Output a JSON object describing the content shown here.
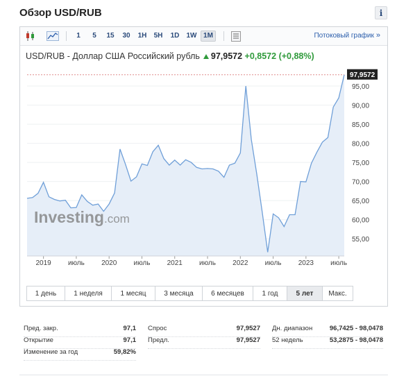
{
  "page": {
    "title": "Обзор USD/RUB",
    "info_icon": "info-icon",
    "info_glyph": "i"
  },
  "toolbar": {
    "icons": [
      "candlestick-icon",
      "area-chart-icon",
      "indicators-icon"
    ],
    "timeframes": [
      "1",
      "5",
      "15",
      "30",
      "1H",
      "5H",
      "1D",
      "1W",
      "1M"
    ],
    "active_timeframe": "1M",
    "stream_link": "Потоковый график",
    "stream_chevron": "»"
  },
  "chart_header": {
    "symbol": "USD/RUB - Доллар США Российский рубль",
    "price": "97,9572",
    "change": "+0,8572",
    "change_pct": "(+0,88%)"
  },
  "chart_data": {
    "type": "area",
    "title": "",
    "x_labels": [
      "2019",
      "июль",
      "2020",
      "июль",
      "2021",
      "июль",
      "2022",
      "июль",
      "2023",
      "июль"
    ],
    "y_ticks": [
      55.0,
      60.0,
      65.0,
      70.0,
      75.0,
      80.0,
      85.0,
      90.0,
      95.0
    ],
    "y_tick_labels": [
      "55,00",
      "60,00",
      "65,00",
      "70,00",
      "75,00",
      "80,00",
      "85,00",
      "90,00",
      "95,00"
    ],
    "ylim": [
      50.5,
      99
    ],
    "last_price": 97.9572,
    "last_price_label": "97,9572",
    "watermark": "Investing.com",
    "series": [
      {
        "x": [
          "2018-10",
          "2018-11",
          "2018-12",
          "2019-01",
          "2019-02",
          "2019-03",
          "2019-04",
          "2019-05",
          "2019-06",
          "2019-07",
          "2019-08",
          "2019-09",
          "2019-10",
          "2019-11",
          "2019-12",
          "2020-01",
          "2020-02",
          "2020-03",
          "2020-04",
          "2020-05",
          "2020-06",
          "2020-07",
          "2020-08",
          "2020-09",
          "2020-10",
          "2020-11",
          "2020-12",
          "2021-01",
          "2021-02",
          "2021-03",
          "2021-04",
          "2021-05",
          "2021-06",
          "2021-07",
          "2021-08",
          "2021-09",
          "2021-10",
          "2021-11",
          "2021-12",
          "2022-01",
          "2022-02",
          "2022-03",
          "2022-04",
          "2022-05",
          "2022-06",
          "2022-07",
          "2022-08",
          "2022-09",
          "2022-10",
          "2022-11",
          "2022-12",
          "2023-01",
          "2023-02",
          "2023-03",
          "2023-04",
          "2023-05",
          "2023-06",
          "2023-07",
          "2023-08"
        ],
        "y": [
          65.6,
          65.8,
          66.9,
          69.8,
          66.0,
          65.3,
          64.9,
          65.1,
          63.1,
          63.2,
          66.5,
          64.8,
          63.8,
          64.1,
          62.2,
          64.1,
          67.0,
          78.5,
          74.5,
          70.1,
          71.2,
          74.6,
          74.2,
          77.8,
          79.5,
          76.0,
          74.3,
          75.6,
          74.3,
          75.7,
          75.0,
          73.7,
          73.3,
          73.4,
          73.3,
          72.7,
          71.1,
          74.3,
          74.8,
          77.5,
          95.0,
          81.0,
          72.0,
          62.0,
          51.5,
          61.5,
          60.5,
          58.2,
          61.3,
          61.3,
          70.0,
          69.9,
          74.8,
          77.7,
          80.3,
          81.5,
          89.5,
          91.9,
          97.96
        ]
      }
    ]
  },
  "ranges": [
    "1 день",
    "1 неделя",
    "1 месяц",
    "3 месяца",
    "6 месяцев",
    "1 год",
    "5 лет",
    "Макс."
  ],
  "active_range": "5 лет",
  "stats": {
    "col1": [
      {
        "label": "Пред. закр.",
        "value": "97,1"
      },
      {
        "label": "Открытие",
        "value": "97,1"
      },
      {
        "label": "Изменение за год",
        "value": "59,82%"
      }
    ],
    "col2": [
      {
        "label": "Спрос",
        "value": "97,9527"
      },
      {
        "label": "Предл.",
        "value": "97,9527"
      }
    ],
    "col3": [
      {
        "label": "Дн. диапазон",
        "value": "96,7425 - 98,0478"
      },
      {
        "label": "52 недель",
        "value": "53,2875 - 98,0478"
      }
    ]
  },
  "colors": {
    "accent": "#2a5dab",
    "line": "#6f9fd8",
    "fill": "#e6eef8",
    "up": "#2f9a3b",
    "price_tag": "#222222"
  }
}
